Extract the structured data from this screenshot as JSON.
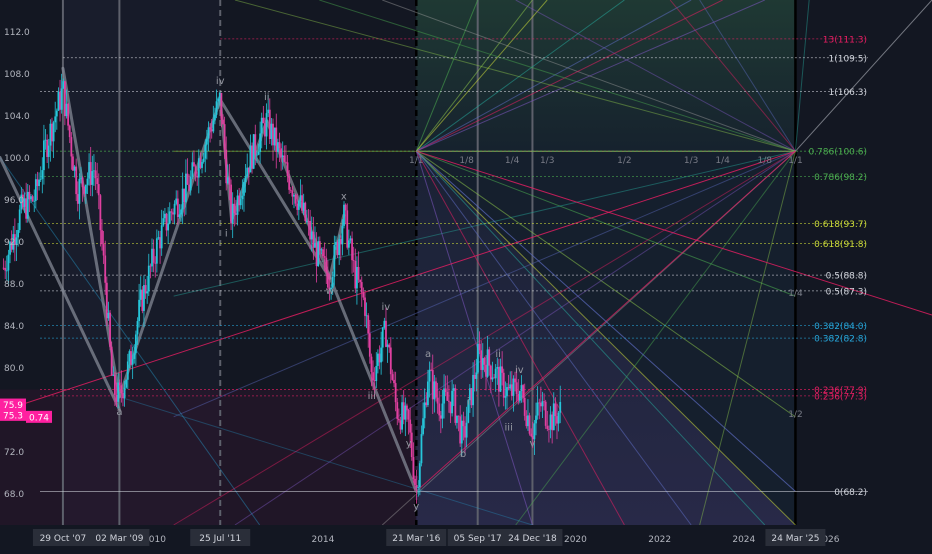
{
  "colors": {
    "background": "#131722",
    "up_candle": "#26c6da",
    "down_candle": "#e040a0",
    "wave_line": "#8a8f9c",
    "price_badge": "#ff20a0",
    "text": "#b2b5be"
  },
  "chart_data": {
    "type": "candlestick",
    "title": "",
    "xlabel": "",
    "ylabel": "",
    "ylim": [
      65.0,
      115.0
    ],
    "xlim": [
      "2006-05-01",
      "2026-12-31"
    ],
    "y_ticks": [
      "68.0",
      "72.0",
      "76.0",
      "80.0",
      "84.0",
      "88.0",
      "92.0",
      "96.0",
      "100.0",
      "104.0",
      "108.0",
      "112.0"
    ],
    "x_ticks": [
      {
        "label": "2010",
        "date": "2010-01-01"
      },
      {
        "label": "12",
        "date": "2012-01-01"
      },
      {
        "label": "2014",
        "date": "2014-01-01"
      },
      {
        "label": "2020",
        "date": "2020-01-01"
      },
      {
        "label": "2022",
        "date": "2022-01-01"
      },
      {
        "label": "2024",
        "date": "2024-01-01"
      },
      {
        "label": "2026",
        "date": "2026-01-01"
      }
    ],
    "date_markers": [
      {
        "label": "29 Oct '07",
        "date": "2007-10-29"
      },
      {
        "label": "02 Mar '09",
        "date": "2009-03-02"
      },
      {
        "label": "25 Jul '11",
        "date": "2011-07-25"
      },
      {
        "label": "21 Mar '16",
        "date": "2016-03-21"
      },
      {
        "label": "05 Sep '17",
        "date": "2017-09-05"
      },
      {
        "label": "24 Dec '18",
        "date": "2018-12-24"
      },
      {
        "label": "24 Mar '25",
        "date": "2025-03-24"
      }
    ],
    "price_path": [
      [
        "2006-06-01",
        89.5
      ],
      [
        "2006-11-01",
        95.0
      ],
      [
        "2007-03-01",
        96.2
      ],
      [
        "2007-06-01",
        101.0
      ],
      [
        "2007-10-29",
        106.5
      ],
      [
        "2008-03-01",
        97.0
      ],
      [
        "2008-08-01",
        99.0
      ],
      [
        "2008-11-01",
        88.0
      ],
      [
        "2009-01-01",
        78.0
      ],
      [
        "2009-03-02",
        77.2
      ],
      [
        "2009-06-01",
        80.5
      ],
      [
        "2009-09-01",
        86.0
      ],
      [
        "2010-02-01",
        92.0
      ],
      [
        "2010-06-01",
        95.0
      ],
      [
        "2010-11-01",
        97.5
      ],
      [
        "2011-03-01",
        101.0
      ],
      [
        "2011-07-25",
        105.5
      ],
      [
        "2011-09-15",
        99.0
      ],
      [
        "2011-11-01",
        94.0
      ],
      [
        "2012-03-01",
        99.0
      ],
      [
        "2012-07-01",
        102.0
      ],
      [
        "2012-09-01",
        103.5
      ],
      [
        "2013-02-01",
        99.0
      ],
      [
        "2013-06-01",
        96.0
      ],
      [
        "2013-11-01",
        91.0
      ],
      [
        "2014-03-01",
        88.5
      ],
      [
        "2014-05-01",
        91.5
      ],
      [
        "2014-07-01",
        94.5
      ],
      [
        "2014-10-01",
        89.0
      ],
      [
        "2015-01-01",
        86.0
      ],
      [
        "2015-03-01",
        79.0
      ],
      [
        "2015-07-01",
        83.5
      ],
      [
        "2015-10-01",
        76.0
      ],
      [
        "2016-01-15",
        74.5
      ],
      [
        "2016-03-21",
        68.2
      ],
      [
        "2016-07-01",
        79.5
      ],
      [
        "2016-10-01",
        76.5
      ],
      [
        "2017-02-01",
        77.0
      ],
      [
        "2017-05-01",
        73.0
      ],
      [
        "2017-09-05",
        81.0
      ],
      [
        "2017-12-01",
        80.5
      ],
      [
        "2018-03-01",
        79.0
      ],
      [
        "2018-06-01",
        77.5
      ],
      [
        "2018-09-01",
        78.0
      ],
      [
        "2018-12-24",
        74.0
      ],
      [
        "2019-03-01",
        76.5
      ],
      [
        "2019-06-01",
        75.0
      ],
      [
        "2019-09-01",
        76.0
      ]
    ],
    "wave_lines": [
      [
        [
          "2009-03-02",
          77.2
        ],
        [
          "2011-07-25",
          105.5
        ]
      ],
      [
        [
          "2011-07-25",
          105.5
        ],
        [
          "2011-11-01",
          94.0
        ]
      ],
      [
        [
          "2011-11-01",
          94.0
        ],
        [
          "2012-09-01",
          103.5
        ]
      ],
      [
        [
          "2011-07-25",
          105.5
        ],
        [
          "2014-03-01",
          88.5
        ]
      ],
      [
        [
          "2014-03-01",
          88.5
        ],
        [
          "2014-07-01",
          94.5
        ]
      ],
      [
        [
          "2012-09-01",
          103.5
        ],
        [
          "2016-03-21",
          68.2
        ]
      ],
      [
        [
          "2007-10-29",
          108.5
        ],
        [
          "2009-03-02",
          77.2
        ]
      ],
      [
        [
          "2006-05-01",
          100.0
        ],
        [
          "2009-03-02",
          76.0
        ]
      ]
    ],
    "wave_labels": [
      {
        "text": "a",
        "date": "2009-03-02",
        "price": 75.5
      },
      {
        "text": "iv",
        "date": "2011-07-25",
        "price": 107.0
      },
      {
        "text": "i",
        "date": "2011-09-15",
        "price": 92.5
      },
      {
        "text": "ii",
        "date": "2012-09-01",
        "price": 105.5
      },
      {
        "text": "x",
        "date": "2014-07-01",
        "price": 96.0
      },
      {
        "text": "w",
        "date": "2014-03-01",
        "price": 87.0
      },
      {
        "text": "iv",
        "date": "2015-07-01",
        "price": 85.5
      },
      {
        "text": "iii",
        "date": "2015-03-01",
        "price": 77.0
      },
      {
        "text": "y",
        "date": "2016-01-15",
        "price": 72.5
      },
      {
        "text": "y",
        "date": "2016-03-21",
        "price": 66.5
      },
      {
        "text": "a",
        "date": "2016-07-01",
        "price": 81.0
      },
      {
        "text": "b",
        "date": "2017-05-01",
        "price": 71.5
      },
      {
        "text": "i",
        "date": "2017-06-15",
        "price": 76.5
      },
      {
        "text": "ii",
        "date": "2018-03-01",
        "price": 81.0
      },
      {
        "text": "iv",
        "date": "2018-09-01",
        "price": 79.5
      },
      {
        "text": "iii",
        "date": "2018-06-01",
        "price": 74.0
      },
      {
        "text": "v",
        "date": "2018-12-24",
        "price": 72.5
      }
    ],
    "horizontal_levels": [
      {
        "label": "1(109.5)",
        "price": 109.5,
        "color": "#d1d4dc",
        "dash": "2,2"
      },
      {
        "label": "1(106.3)",
        "price": 106.3,
        "color": "#d1d4dc",
        "dash": "2,2"
      },
      {
        "label": "0.786(100.6)",
        "price": 100.6,
        "color": "#4caf50",
        "dash": "2,2"
      },
      {
        "label": "0.786(98.2)",
        "price": 98.2,
        "color": "#4caf50",
        "dash": "2,2"
      },
      {
        "label": "0.618(93.7)",
        "price": 93.7,
        "color": "#cddc39",
        "dash": "2,2"
      },
      {
        "label": "0.618(91.8)",
        "price": 91.8,
        "color": "#cddc39",
        "dash": "2,2"
      },
      {
        "label": "0.5(88.8)",
        "price": 88.8,
        "color": "#d1d4dc",
        "dash": "2,2"
      },
      {
        "label": "0.5(87.3)",
        "price": 87.3,
        "color": "#d1d4dc",
        "dash": "2,2"
      },
      {
        "label": "0.382(84.0)",
        "price": 84.0,
        "color": "#26a6da",
        "dash": "2,2"
      },
      {
        "label": "0.382(82.8)",
        "price": 82.8,
        "color": "#26a6da",
        "dash": "2,2"
      },
      {
        "label": "0.236(77.9)",
        "price": 77.9,
        "color": "#e91e63",
        "dash": "2,2"
      },
      {
        "label": "0.236(77.3)",
        "price": 77.3,
        "color": "#e91e63",
        "dash": "2,2"
      },
      {
        "label": "0(68.2)",
        "price": 68.2,
        "color": "#d1d4dc",
        "dash": ""
      },
      {
        "label": "13(111.3)",
        "price": 111.3,
        "color": "#e91e63",
        "dash": "2,2"
      }
    ],
    "price_badges": [
      {
        "text": "75.9",
        "price": 75.9
      },
      {
        "text": "75.3",
        "price": 75.3
      },
      {
        "text": "0.74",
        "price": 75.3
      }
    ],
    "gann_labels": [
      {
        "text": "1/1",
        "date": "2016-03-21",
        "price": 99.5
      },
      {
        "text": "1/8",
        "date": "2017-06-01",
        "price": 99.5
      },
      {
        "text": "1/4",
        "date": "2018-07-01",
        "price": 99.5
      },
      {
        "text": "1/3",
        "date": "2019-05-01",
        "price": 99.5
      },
      {
        "text": "1/2",
        "date": "2021-03-01",
        "price": 99.5
      },
      {
        "text": "1/3",
        "date": "2022-10-01",
        "price": 99.5
      },
      {
        "text": "1/4",
        "date": "2023-07-01",
        "price": 99.5
      },
      {
        "text": "1/8",
        "date": "2024-07-01",
        "price": 99.5
      },
      {
        "text": "1/1",
        "date": "2025-03-24",
        "price": 99.5
      },
      {
        "text": "1/4",
        "date": "2025-03-24",
        "price": 86.8
      },
      {
        "text": "1/2",
        "date": "2025-03-24",
        "price": 75.3
      }
    ]
  }
}
